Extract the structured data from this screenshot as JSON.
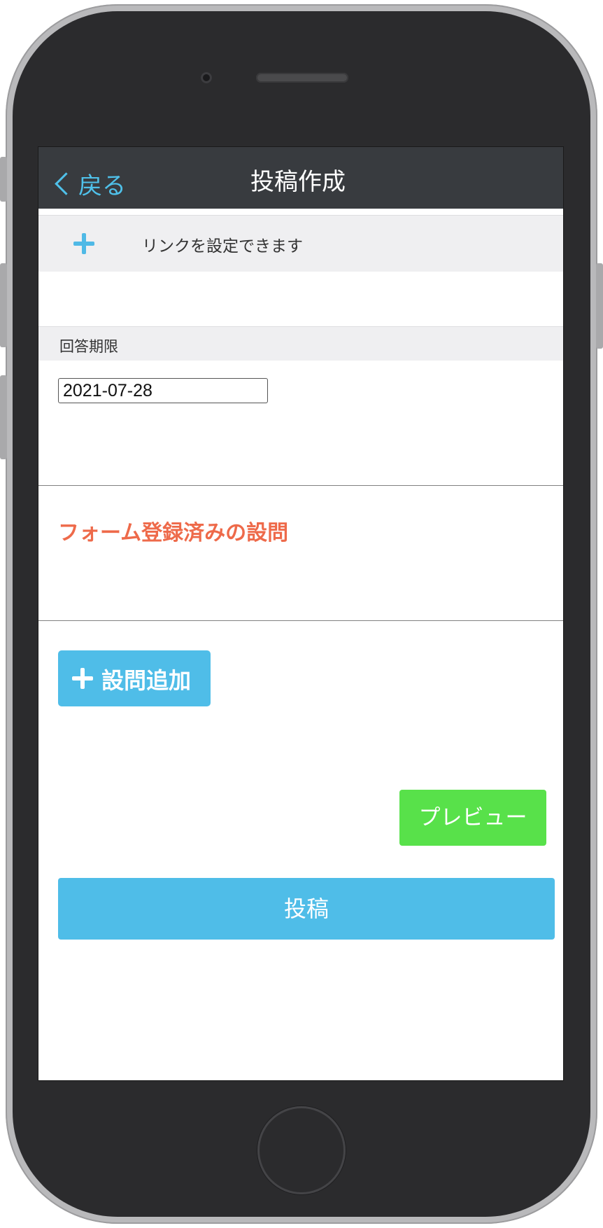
{
  "navbar": {
    "back_label": "戻る",
    "title": "投稿作成"
  },
  "link_row": {
    "icon": "plus-icon",
    "text": "リンクを設定できます"
  },
  "deadline": {
    "header": "回答期限",
    "date_value": "2021-07-28"
  },
  "form": {
    "registered_title": "フォーム登録済みの設問"
  },
  "actions": {
    "add_question_label": "設問追加",
    "preview_label": "プレビュー",
    "post_label": "投稿"
  },
  "colors": {
    "accent_blue": "#4fbde8",
    "preview_green": "#58e14a",
    "title_red": "#ee6a4a",
    "navbar_bg": "#383b3f"
  }
}
